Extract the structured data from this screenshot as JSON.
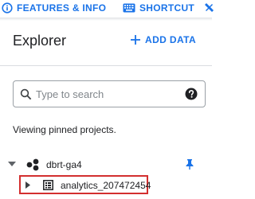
{
  "topbar": {
    "features_label": "FEATURES & INFO",
    "shortcut_label": "SHORTCUT",
    "accent_color": "#1a73e8"
  },
  "explorer": {
    "title": "Explorer",
    "add_data_label": "+ ADD DATA",
    "add_data_text": "ADD DATA"
  },
  "search": {
    "placeholder": "Type to search",
    "value": ""
  },
  "pinned_note": "Viewing pinned projects.",
  "tree": {
    "project": {
      "name": "dbrt-ga4",
      "expanded": true,
      "pinned": true
    },
    "dataset": {
      "name": "analytics_207472454",
      "expanded": false,
      "highlight_color": "#d32f2f"
    }
  }
}
